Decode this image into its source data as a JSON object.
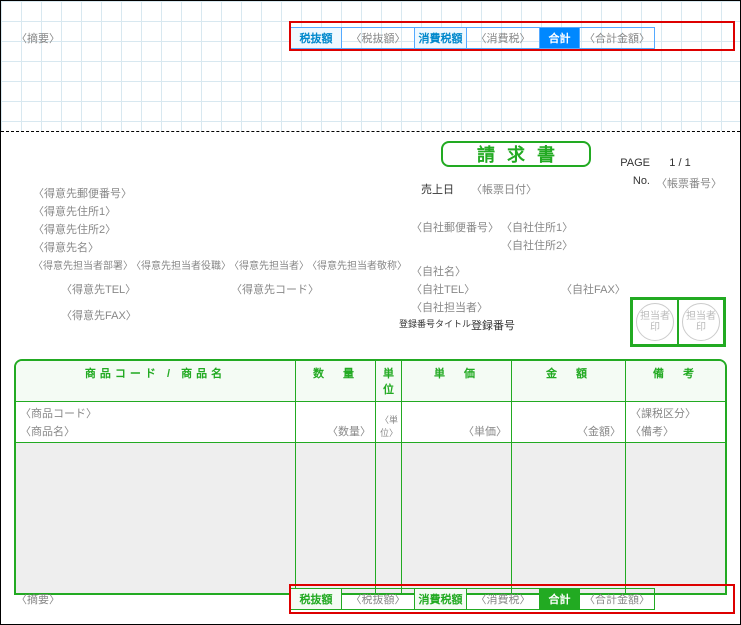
{
  "topSummary": {
    "leftLabel": "〈摘要〉",
    "cells": {
      "zeinuki_label": "税抜額",
      "zeinuki_value": "〈税抜額〉",
      "shouhizei_label": "消費税額",
      "shouhizei_value": "〈消費税〉",
      "goukei_label": "合計",
      "goukei_value": "〈合計金額〉"
    }
  },
  "invoice": {
    "title": "請求書"
  },
  "pageInfo": {
    "page_label": "PAGE",
    "page_value": "1 / 1",
    "no_label": "No.",
    "no_value": "〈帳票番号〉"
  },
  "headerFields": {
    "tokuisaki_yuubin": "〈得意先郵便番号〉",
    "tokuisaki_addr1": "〈得意先住所1〉",
    "tokuisaki_addr2": "〈得意先住所2〉",
    "tokuisaki_mei": "〈得意先名〉",
    "tokuisaki_busho": "〈得意先担当者部署〉",
    "tokuisaki_yakushoku": "〈得意先担当者役職〉",
    "tokuisaki_tantousha": "〈得意先担当者〉",
    "tokuisaki_keishou": "〈得意先担当者敬称〉",
    "tokuisaki_tel": "〈得意先TEL〉",
    "tokuisaki_fax": "〈得意先FAX〉",
    "tokuisaki_code": "〈得意先コード〉",
    "uriage_label": "売上日",
    "uriage_value": "〈帳票日付〉",
    "jisha_yuubin": "〈自社郵便番号〉",
    "jisha_addr1": "〈自社住所1〉",
    "jisha_addr2": "〈自社住所2〉",
    "jisha_mei": "〈自社名〉",
    "jisha_tel": "〈自社TEL〉",
    "jisha_fax": "〈自社FAX〉",
    "jisha_tantousha": "〈自社担当者〉",
    "touroku_title": "登録番号タイトル",
    "touroku_value": "登録番号"
  },
  "seals": {
    "seal1": "担当者印",
    "seal2": "担当者印"
  },
  "table": {
    "headers": {
      "code": "商品コード / 商品名",
      "qty": "数　量",
      "unit": "単位",
      "price": "単　価",
      "amount": "金　額",
      "note": "備　考"
    },
    "row": {
      "code1": "〈商品コード〉",
      "code2": "〈商品名〉",
      "qty": "〈数量〉",
      "unit": "〈単位〉",
      "price": "〈単価〉",
      "amount": "〈金額〉",
      "note1": "〈課税区分〉",
      "note2": "〈備考〉"
    }
  },
  "bottomSummary": {
    "leftLabel": "〈摘要〉",
    "cells": {
      "zeinuki_label": "税抜額",
      "zeinuki_value": "〈税抜額〉",
      "shouhizei_label": "消費税額",
      "shouhizei_value": "〈消費税〉",
      "goukei_label": "合計",
      "goukei_value": "〈合計金額〉"
    }
  }
}
